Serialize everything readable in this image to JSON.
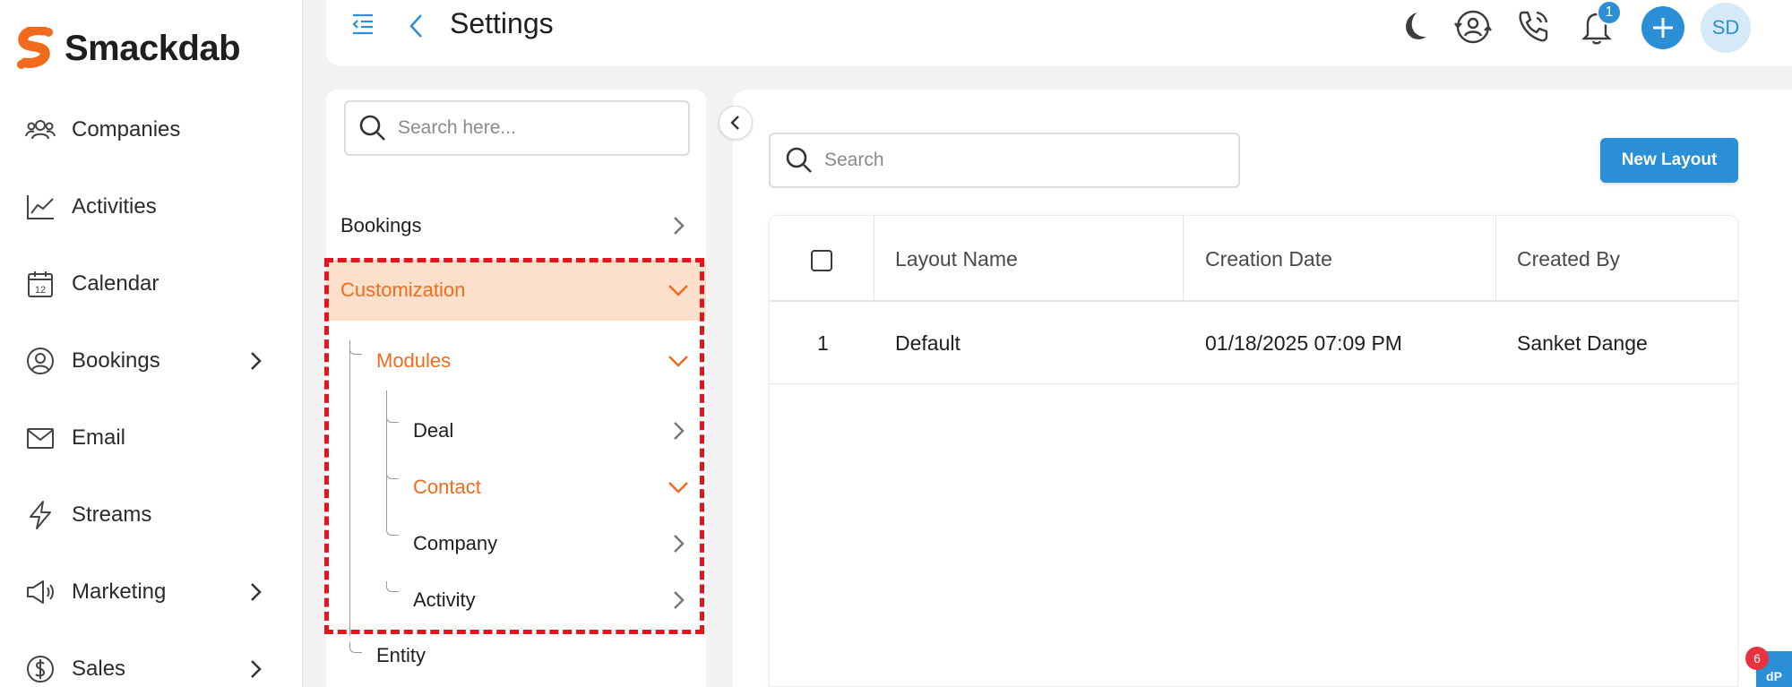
{
  "brand": {
    "name": "Smackdab",
    "accent": "#f26b1d",
    "primary": "#2a8fd4"
  },
  "sidebar": {
    "items": [
      {
        "label": "Companies",
        "icon": "users-icon",
        "has_chevron": false
      },
      {
        "label": "Activities",
        "icon": "line-chart-icon",
        "has_chevron": false
      },
      {
        "label": "Calendar",
        "icon": "calendar-icon",
        "has_chevron": false
      },
      {
        "label": "Bookings",
        "icon": "user-circle-icon",
        "has_chevron": true
      },
      {
        "label": "Email",
        "icon": "mail-icon",
        "has_chevron": false
      },
      {
        "label": "Streams",
        "icon": "lightning-icon",
        "has_chevron": false
      },
      {
        "label": "Marketing",
        "icon": "megaphone-icon",
        "has_chevron": true
      },
      {
        "label": "Sales",
        "icon": "dollar-circle-icon",
        "has_chevron": true
      }
    ],
    "calendar_day": "12"
  },
  "header": {
    "title": "Settings",
    "notification_count": "1",
    "avatar_initials": "SD"
  },
  "tree": {
    "search_placeholder": "Search here...",
    "items": {
      "bookings": "Bookings",
      "customization": "Customization",
      "modules": "Modules",
      "deal": "Deal",
      "contact": "Contact",
      "company": "Company",
      "activity": "Activity",
      "entity": "Entity"
    }
  },
  "main": {
    "search_placeholder": "Search",
    "new_layout_label": "New Layout",
    "columns": [
      "Layout Name",
      "Creation Date",
      "Created By"
    ],
    "rows": [
      {
        "index": "1",
        "layout_name": "Default",
        "creation_date": "01/18/2025 07:09 PM",
        "created_by": "Sanket Dange"
      }
    ]
  },
  "corner": {
    "badge_count": "6",
    "tab_label": "dP"
  }
}
